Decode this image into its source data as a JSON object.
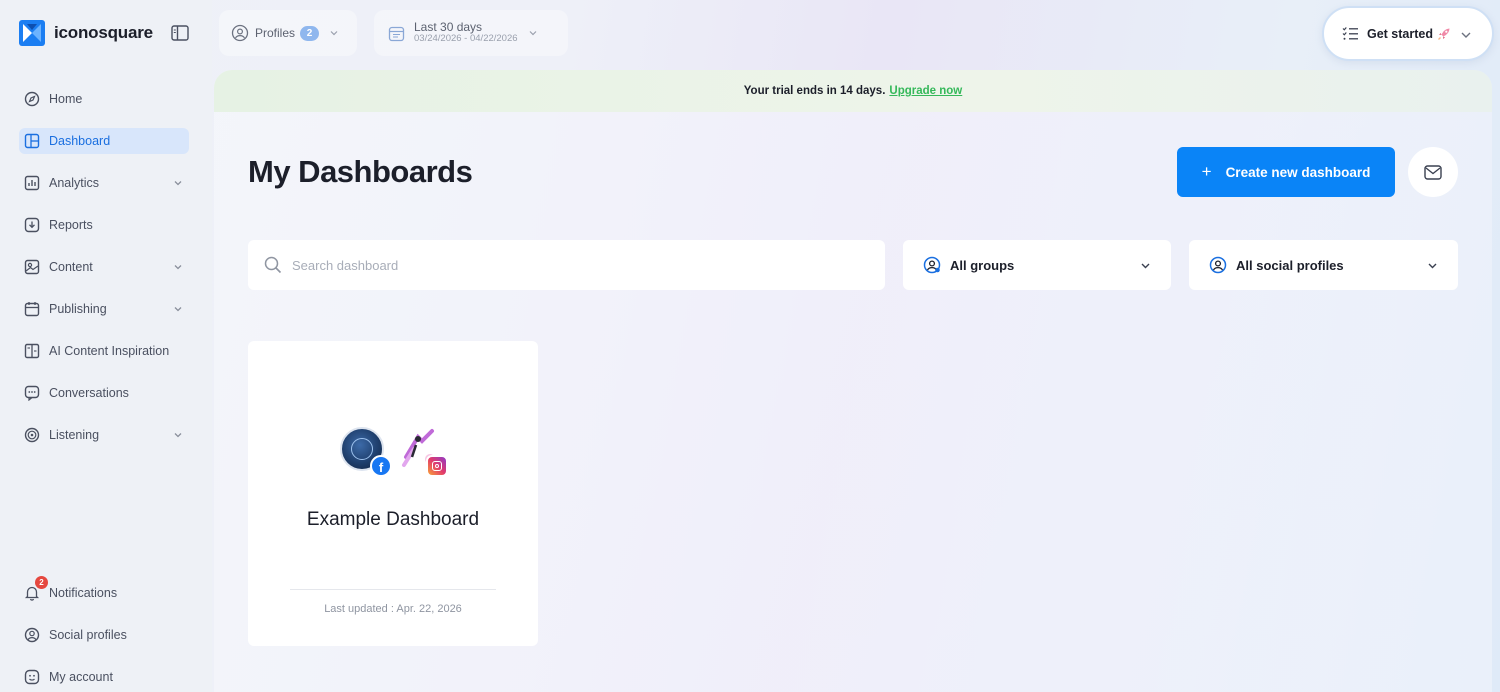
{
  "app": {
    "brand": "iconosquare"
  },
  "sidebar": {
    "items": [
      {
        "label": "Home",
        "icon": "compass-icon"
      },
      {
        "label": "Dashboard",
        "icon": "dashboard-icon",
        "active": true
      },
      {
        "label": "Analytics",
        "icon": "bar-chart-icon",
        "expandable": true
      },
      {
        "label": "Reports",
        "icon": "download-icon"
      },
      {
        "label": "Content",
        "icon": "image-icon",
        "expandable": true
      },
      {
        "label": "Publishing",
        "icon": "calendar-icon",
        "expandable": true
      },
      {
        "label": "AI Content Inspiration",
        "icon": "layout-icon"
      },
      {
        "label": "Conversations",
        "icon": "chat-icon"
      },
      {
        "label": "Listening",
        "icon": "radar-icon",
        "expandable": true
      }
    ],
    "bottom": [
      {
        "label": "Notifications",
        "icon": "bell-icon",
        "badge": "2"
      },
      {
        "label": "Social profiles",
        "icon": "profile-icon"
      },
      {
        "label": "My account",
        "icon": "smiley-icon"
      }
    ]
  },
  "topbar": {
    "profiles_label": "Profiles",
    "profiles_count": "2",
    "date_range_label": "Last 30 days",
    "date_range_value": "03/24/2026 - 04/22/2026",
    "get_started_label": "Get started"
  },
  "banner": {
    "message": "Your trial ends in 14 days.",
    "link": "Upgrade now"
  },
  "main": {
    "title": "My Dashboards",
    "create_button": "Create new dashboard",
    "search_placeholder": "Search dashboard",
    "groups_select": "All groups",
    "profiles_select": "All social profiles"
  },
  "dashboards": [
    {
      "title": "Example Dashboard",
      "updated": "Last updated : Apr. 22, 2026"
    }
  ],
  "colors": {
    "accent": "#0a84f7",
    "active_nav_bg": "#d8e6fb",
    "upgrade_link": "#35b85a",
    "badge": "#e5483f"
  }
}
